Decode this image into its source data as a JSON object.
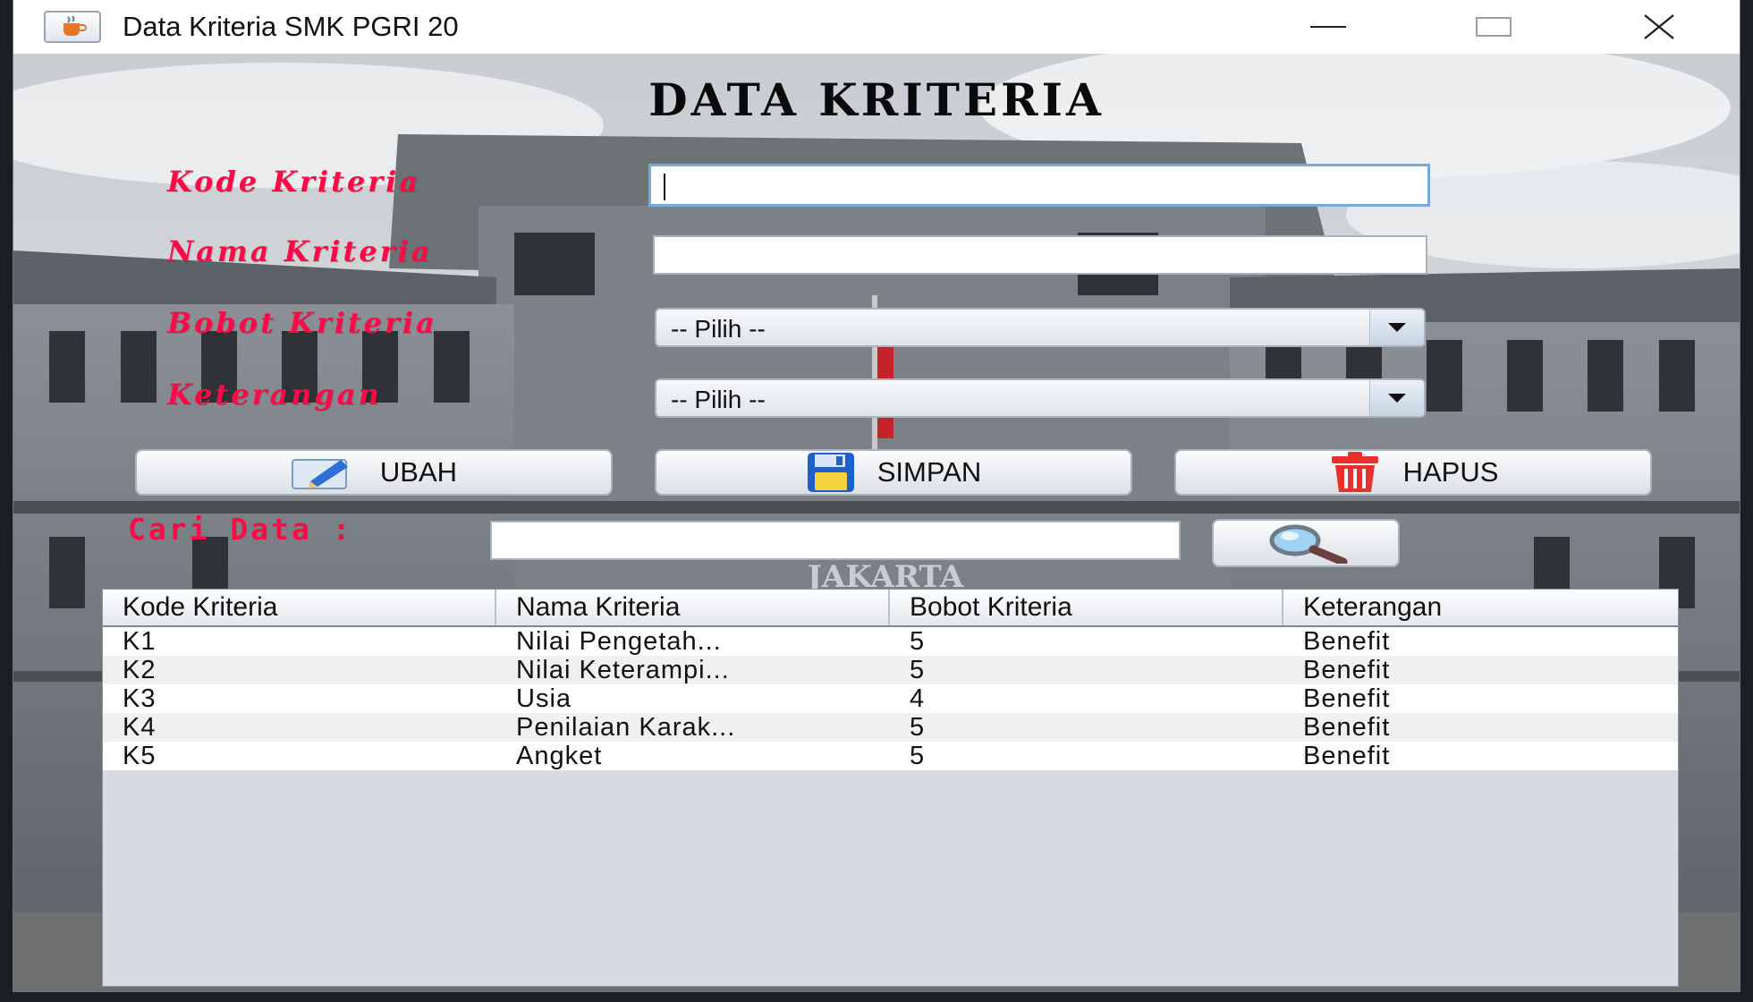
{
  "window": {
    "title": "Data Kriteria SMK PGRI 20",
    "icon": "java-cup-icon",
    "controls": {
      "minimize": "minimize-icon",
      "maximize": "maximize-icon",
      "close": "close-icon"
    }
  },
  "form": {
    "title": "DATA KRITERIA",
    "fields": {
      "kode_label": "Kode Kriteria",
      "kode_value": "",
      "nama_label": "Nama Kriteria",
      "nama_value": "",
      "bobot_label": "Bobot Kriteria",
      "bobot_selected": "-- Pilih --",
      "keterangan_label": "Keterangan",
      "keterangan_selected": "-- Pilih --"
    },
    "buttons": {
      "ubah": "UBAH",
      "simpan": "SIMPAN",
      "hapus": "HAPUS"
    },
    "search": {
      "label": "Cari Data :",
      "value": "",
      "button_icon": "magnifier-icon"
    },
    "background_sign": "JAKARTA"
  },
  "table": {
    "columns": [
      "Kode Kriteria",
      "Nama Kriteria",
      "Bobot Kriteria",
      "Keterangan"
    ],
    "rows": [
      [
        "K1",
        "Nilai Pengetah...",
        "5",
        "Benefit"
      ],
      [
        "K2",
        "Nilai Keterampi...",
        "5",
        "Benefit"
      ],
      [
        "K3",
        "Usia",
        "4",
        "Benefit"
      ],
      [
        "K4",
        "Penilaian Karak...",
        "5",
        "Benefit"
      ],
      [
        "K5",
        "Angket",
        "5",
        "Benefit"
      ]
    ]
  },
  "colors": {
    "label_red": "#ff0a46",
    "focus_border": "#7aa8de"
  }
}
